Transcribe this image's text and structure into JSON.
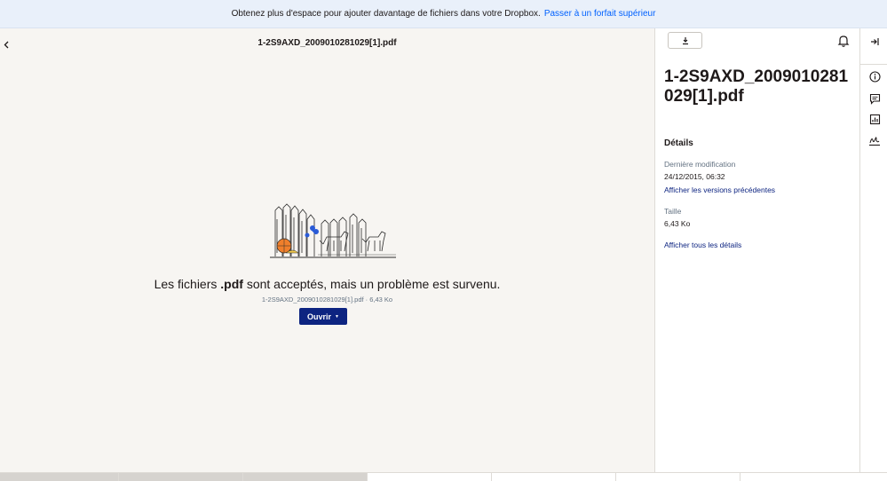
{
  "banner": {
    "text": "Obtenez plus d'espace pour ajouter davantage de fichiers dans votre Dropbox.",
    "link": "Passer à un forfait supérieur"
  },
  "preview": {
    "back_icon": "chevron-left-icon",
    "file_title": "1-2S9AXD_2009010281029[1].pdf",
    "error_prefix": "Les fichiers ",
    "error_ext": ".pdf",
    "error_suffix": " sont acceptés, mais un problème est survenu.",
    "file_meta": "1-2S9AXD_2009010281029[1].pdf · 6,43 Ko",
    "open_label": "Ouvrir"
  },
  "sidebar": {
    "title": "1-2S9AXD_2009010281029[1].pdf",
    "details_heading": "Détails",
    "modified_label": "Dernière modification",
    "modified_value": "24/12/2015, 06:32",
    "versions_link": "Afficher les versions précédentes",
    "size_label": "Taille",
    "size_value": "6,43 Ko",
    "all_details_link": "Afficher tous les détails"
  },
  "icons": {
    "download": "download-icon",
    "bell": "bell-icon",
    "collapse": "collapse-panel-icon",
    "info": "info-icon",
    "comment": "comment-icon",
    "activity": "activity-chart-icon",
    "signature": "signature-icon"
  },
  "colors": {
    "banner_bg": "#e9f0fa",
    "link": "#0061fe",
    "primary_button": "#0d2481",
    "preview_bg": "#f7f5f2"
  }
}
